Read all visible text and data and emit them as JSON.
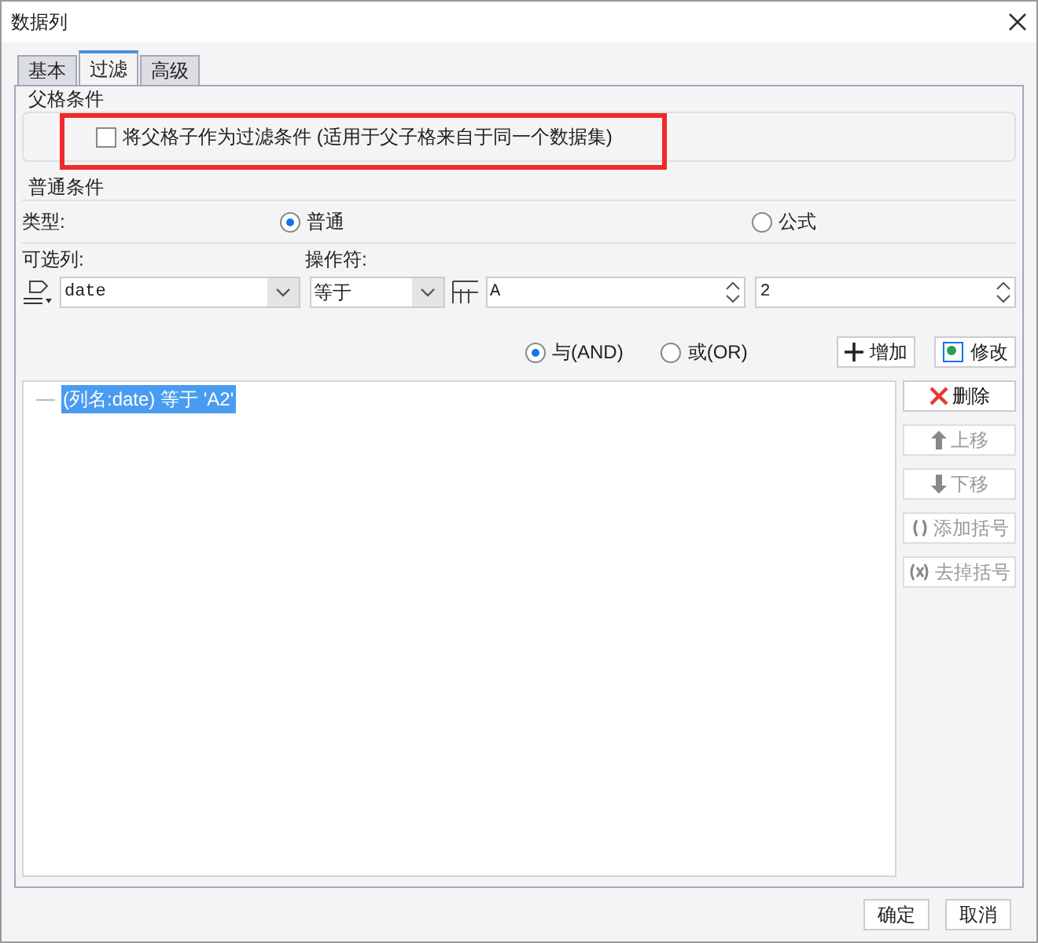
{
  "window": {
    "title": "数据列"
  },
  "tabs": [
    {
      "label": "基本",
      "selected": false
    },
    {
      "label": "过滤",
      "selected": true
    },
    {
      "label": "高级",
      "selected": false
    }
  ],
  "parent_section": {
    "title": "父格条件",
    "checkbox": {
      "label": "将父格子作为过滤条件 (适用于父子格来自于同一个数据集)",
      "checked": false
    },
    "highlighted": true
  },
  "general_section": {
    "title": "普通条件",
    "type_label": "类型:",
    "type_options": [
      {
        "label": "普通",
        "selected": true
      },
      {
        "label": "公式",
        "selected": false
      }
    ],
    "column_label": "可选列:",
    "column_value": "date",
    "operator_label": "操作符:",
    "operator_value": "等于",
    "cell_column": "A",
    "cell_row": "2",
    "logic_options": [
      {
        "label": "与(AND)",
        "selected": true
      },
      {
        "label": "或(OR)",
        "selected": false
      }
    ],
    "add_button": "增加",
    "modify_button": "修改"
  },
  "conditions": [
    {
      "text": "(列名:date) 等于 'A2'",
      "selected": true
    }
  ],
  "side_buttons": [
    {
      "kind": "delete",
      "label": "删除",
      "disabled": false
    },
    {
      "kind": "up",
      "label": "上移",
      "disabled": true
    },
    {
      "kind": "down",
      "label": "下移",
      "disabled": true
    },
    {
      "kind": "add-bracket",
      "label": "添加括号",
      "disabled": true
    },
    {
      "kind": "remove-bracket",
      "label": "去掉括号",
      "disabled": true
    }
  ],
  "footer_buttons": [
    "确定",
    "取消"
  ]
}
